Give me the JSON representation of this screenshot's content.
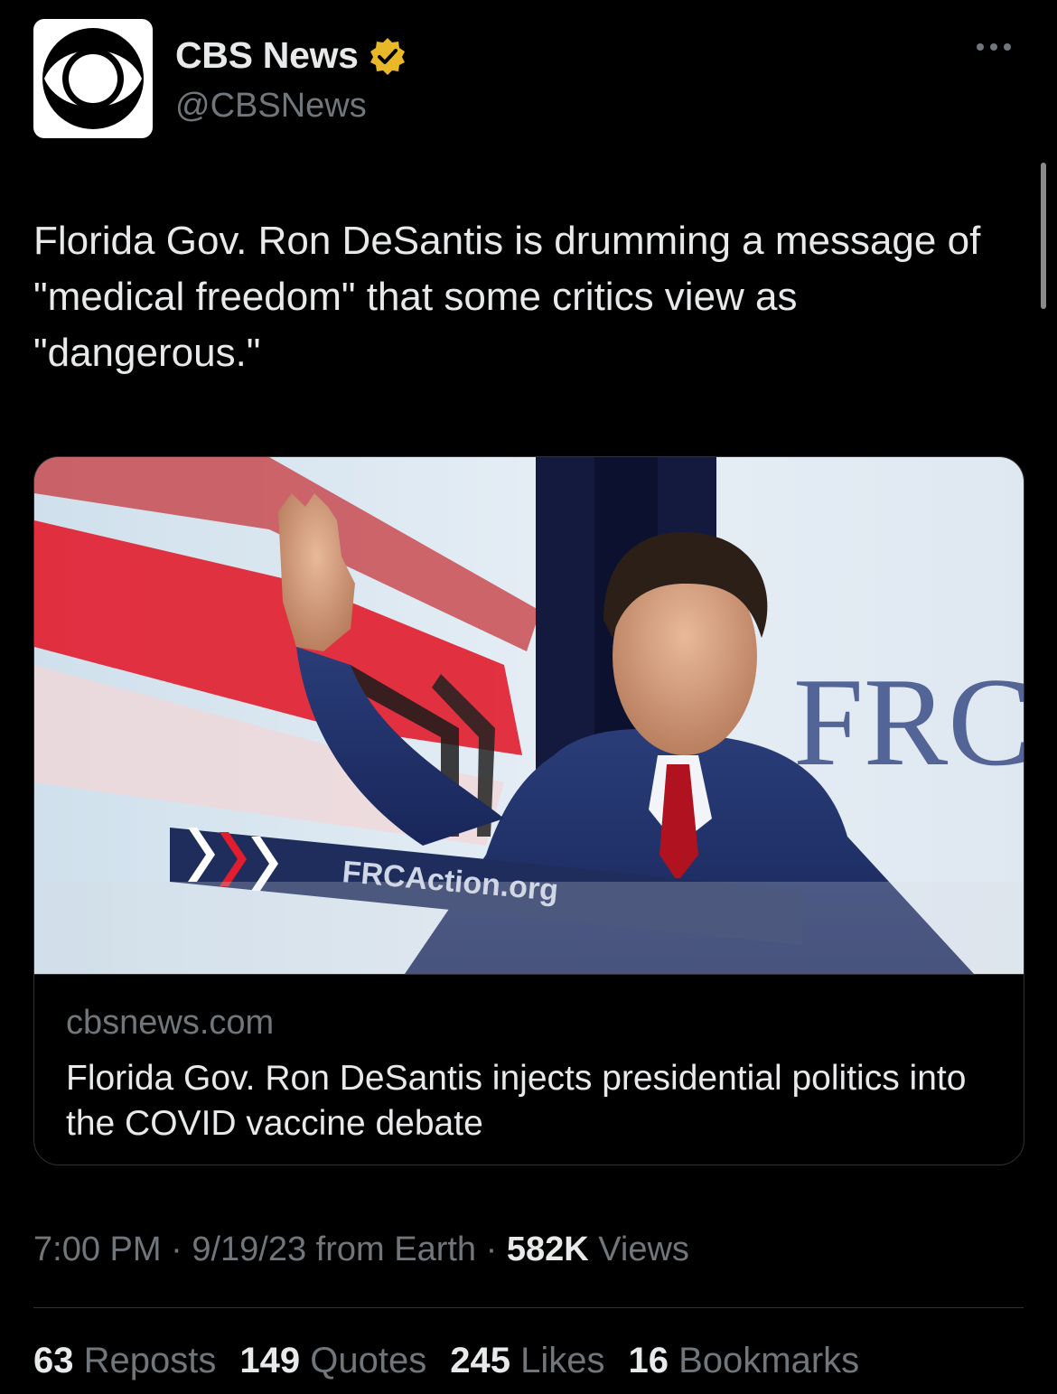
{
  "author": {
    "display_name": "CBS News",
    "handle": "@CBSNews",
    "verified": true,
    "badge_color": "#E8B829"
  },
  "tweet": {
    "text": "Florida Gov. Ron DeSantis is drumming a message of \"medical freedom\" that some critics view as \"dangerous.\""
  },
  "card": {
    "domain": "cbsnews.com",
    "title": "Florida Gov. Ron DeSantis injects presidential politics into the COVID vaccine debate",
    "image": {
      "backdrop_sign": "FRC",
      "podium_sign": "FRCAction.org"
    }
  },
  "meta": {
    "time": "7:00 PM",
    "date": "9/19/23",
    "source": "from Earth",
    "views_count": "582K",
    "views_label": "Views"
  },
  "stats": [
    {
      "count": "63",
      "label": "Reposts"
    },
    {
      "count": "149",
      "label": "Quotes"
    },
    {
      "count": "245",
      "label": "Likes"
    },
    {
      "count": "16",
      "label": "Bookmarks"
    }
  ],
  "icons": {
    "avatar": "cbs-eye-logo",
    "badge": "verified-badge-icon",
    "more": "more-options-icon"
  }
}
